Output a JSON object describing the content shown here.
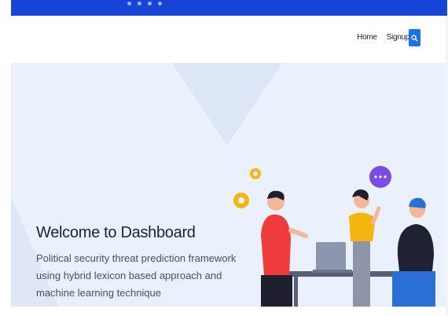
{
  "topbar": {
    "social_icons": [
      "facebook-icon",
      "twitter-icon",
      "instagram-icon",
      "linkedin-icon"
    ]
  },
  "nav": {
    "home_label": "Home",
    "signup_label": "Signup",
    "search_icon": "search-icon"
  },
  "hero": {
    "title": "Welcome to Dashboard",
    "subtitle": "Political security threat prediction framework using hybrid lexicon based approach and machine learning technique"
  },
  "colors": {
    "topbar": "#1744d6",
    "hero_bg": "#eaf0fc",
    "search_button": "#1a73e8"
  }
}
